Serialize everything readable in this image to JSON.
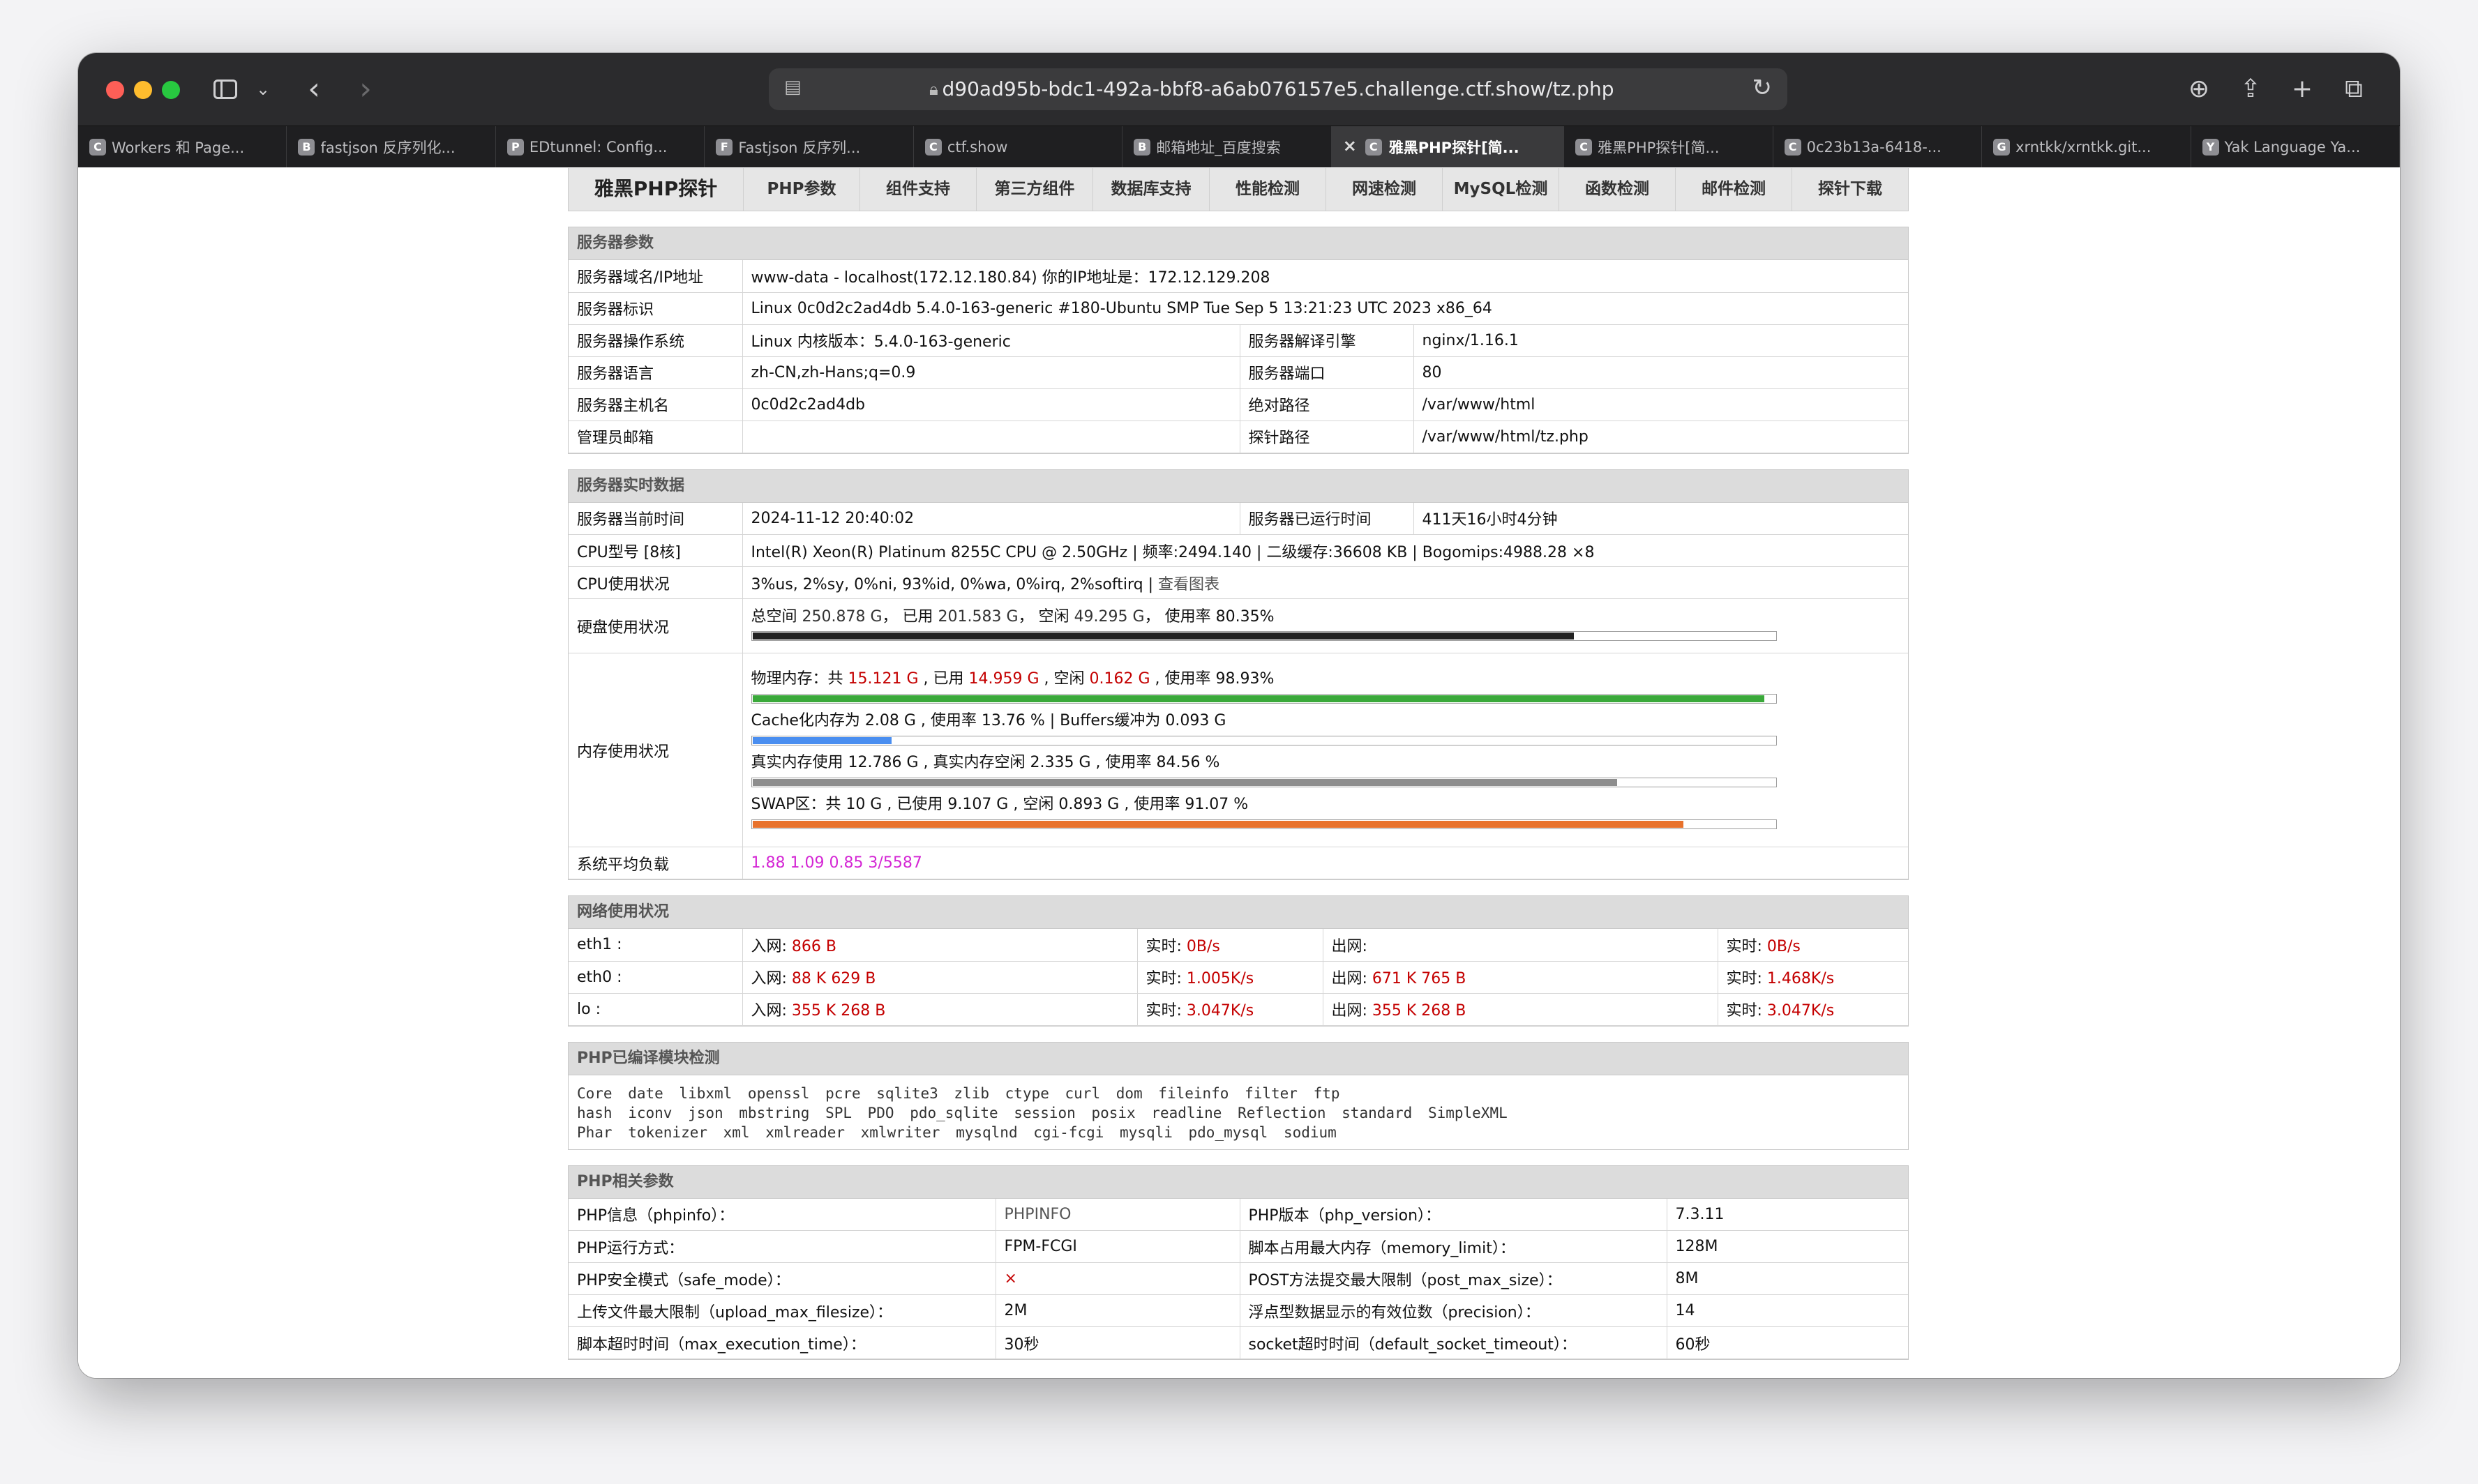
{
  "browser": {
    "url": "d90ad95b-bdc1-492a-bbf8-a6ab076157e5.challenge.ctf.show/tz.php",
    "tabs": [
      {
        "label": "Workers 和 Page...",
        "fav": "C"
      },
      {
        "label": "fastjson 反序列化...",
        "fav": "B"
      },
      {
        "label": "EDtunnel: Config...",
        "fav": "P"
      },
      {
        "label": "Fastjson 反序列...",
        "fav": "F"
      },
      {
        "label": "ctf.show",
        "fav": "C"
      },
      {
        "label": "邮箱地址_百度搜索",
        "fav": "B"
      },
      {
        "label": "雅黑PHP探针[简...",
        "fav": "C",
        "active": true
      },
      {
        "label": "雅黑PHP探针[简...",
        "fav": "C"
      },
      {
        "label": "0c23b13a-6418-...",
        "fav": "C"
      },
      {
        "label": "xrntkk/xrntkk.git...",
        "fav": "G"
      },
      {
        "label": "Yak Language Ya...",
        "fav": "Y"
      }
    ]
  },
  "nav": {
    "brand": "雅黑PHP探针",
    "items": [
      "PHP参数",
      "组件支持",
      "第三方组件",
      "数据库支持",
      "性能检测",
      "网速检测",
      "MySQL检测",
      "函数检测",
      "邮件检测",
      "探针下载"
    ]
  },
  "server": {
    "title": "服务器参数",
    "domain_label": "服务器域名/IP地址",
    "domain_value": "www-data - localhost(172.12.180.84)  你的IP地址是：172.12.129.208",
    "ident_label": "服务器标识",
    "ident_value": "Linux 0c0d2c2ad4db 5.4.0-163-generic #180-Ubuntu SMP Tue Sep 5 13:21:23 UTC 2023 x86_64",
    "os_label": "服务器操作系统",
    "os_value": "Linux  内核版本：5.4.0-163-generic",
    "engine_label": "服务器解译引擎",
    "engine_value": "nginx/1.16.1",
    "lang_label": "服务器语言",
    "lang_value": "zh-CN,zh-Hans;q=0.9",
    "port_label": "服务器端口",
    "port_value": "80",
    "host_label": "服务器主机名",
    "host_value": "0c0d2c2ad4db",
    "abspath_label": "绝对路径",
    "abspath_value": "/var/www/html",
    "admin_label": "管理员邮箱",
    "admin_value": "",
    "probe_label": "探针路径",
    "probe_value": "/var/www/html/tz.php"
  },
  "realtime": {
    "title": "服务器实时数据",
    "time_label": "服务器当前时间",
    "time_value": "2024-11-12 20:40:02",
    "uptime_label": "服务器已运行时间",
    "uptime_value": "411天16小时4分钟",
    "cpu_label": "CPU型号 [8核]",
    "cpu_value": "Intel(R) Xeon(R) Platinum 8255C CPU @ 2.50GHz | 频率:2494.140 | 二级缓存:36608 KB | Bogomips:4988.28 ×8",
    "cpuuse_label": "CPU使用状况",
    "cpuuse_value": "3%us, 2%sy, 0%ni, 93%id, 0%wa, 0%irq, 2%softirq | ",
    "cpuuse_link": "查看图表",
    "disk_label": "硬盘使用状况",
    "disk": {
      "p1": "总空间 ",
      "total": "250.878 G",
      "p2": "，  已用 ",
      "used": "201.583 G",
      "p3": "，  空闲 ",
      "free": "49.295 G",
      "p4": "，  使用率 ",
      "rate": "80.35%",
      "percent": 80.35,
      "color": "#222222"
    },
    "mem_label": "内存使用状况",
    "mem": {
      "p1": "物理内存：共 ",
      "total": "15.121 G",
      "p2": " , 已用 ",
      "used": "14.959 G",
      "p3": " , 空闲 ",
      "free": "0.162 G",
      "p4": " , 使用率 ",
      "rate": "98.93%",
      "percent": 98.93,
      "color": "#3aa93a"
    },
    "cache": {
      "text": "Cache化内存为 2.08 G , 使用率 13.76 % | Buffers缓冲为 0.093 G",
      "percent": 13.76,
      "color": "#4a8ef0"
    },
    "real": {
      "text": "真实内存使用 12.786 G , 真实内存空闲 2.335 G , 使用率 84.56 %",
      "percent": 84.56,
      "color": "#8e8e8e"
    },
    "swap": {
      "text": "SWAP区：共 10 G , 已使用 9.107 G , 空闲 0.893 G , 使用率 91.07 %",
      "percent": 91.07,
      "color": "#e8722c"
    },
    "load_label": "系统平均负载",
    "load_value": "1.88 1.09 0.85 3/5587"
  },
  "network": {
    "title": "网络使用状况",
    "rows": [
      {
        "iface": "eth1 :",
        "in_label": "入网: ",
        "in": "866 B",
        "rt1_label": "实时: ",
        "rt1": "0B/s",
        "out_label": "出网: ",
        "out": "",
        "rt2_label": "实时: ",
        "rt2": "0B/s"
      },
      {
        "iface": "eth0 :",
        "in_label": "入网: ",
        "in": "88 K 629 B",
        "rt1_label": "实时: ",
        "rt1": "1.005K/s",
        "out_label": "出网: ",
        "out": "671 K 765 B",
        "rt2_label": "实时: ",
        "rt2": "1.468K/s"
      },
      {
        "iface": "lo :",
        "in_label": "入网: ",
        "in": "355 K 268 B",
        "rt1_label": "实时: ",
        "rt1": "3.047K/s",
        "out_label": "出网: ",
        "out": "355 K 268 B",
        "rt2_label": "实时: ",
        "rt2": "3.047K/s"
      }
    ]
  },
  "modules": {
    "title": "PHP已编译模块检测",
    "lines": [
      "Core  date  libxml  openssl  pcre  sqlite3  zlib  ctype  curl  dom  fileinfo  filter  ftp",
      "hash  iconv  json  mbstring  SPL  PDO  pdo_sqlite  session  posix  readline  Reflection  standard  SimpleXML",
      "Phar  tokenizer  xml  xmlreader  xmlwriter  mysqlnd  cgi-fcgi  mysqli  pdo_mysql  sodium"
    ]
  },
  "php": {
    "title": "PHP相关参数",
    "rows": [
      {
        "l1": "PHP信息（phpinfo）：",
        "v1": "PHPINFO",
        "l2": "PHP版本（php_version）：",
        "v2": "7.3.11"
      },
      {
        "l1": "PHP运行方式：",
        "v1": "FPM-FCGI",
        "l2": "脚本占用最大内存（memory_limit）：",
        "v2": "128M"
      },
      {
        "l1": "PHP安全模式（safe_mode）：",
        "v1": "×",
        "l2": "POST方法提交最大限制（post_max_size）：",
        "v2": "8M"
      },
      {
        "l1": "上传文件最大限制（upload_max_filesize）：",
        "v1": "2M",
        "l2": "浮点型数据显示的有效位数（precision）：",
        "v2": "14"
      },
      {
        "l1": "脚本超时时间（max_execution_time）：",
        "v1": "30秒",
        "l2": "socket超时时间（default_socket_timeout）：",
        "v2": "60秒"
      }
    ]
  }
}
